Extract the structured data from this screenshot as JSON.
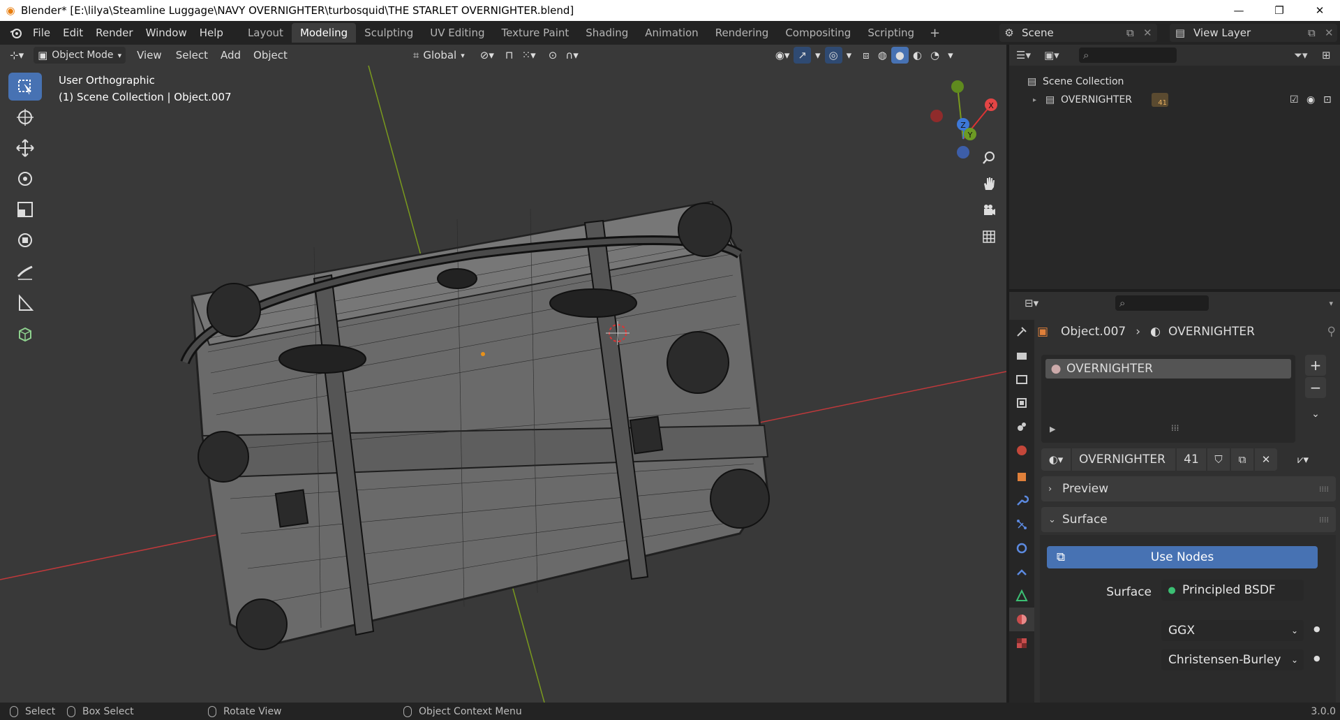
{
  "window": {
    "title": "Blender* [E:\\lilya\\Steamline Luggage\\NAVY OVERNIGHTER\\turbosquid\\THE STARLET OVERNIGHTER.blend]",
    "minimize_glyph": "—",
    "restore_glyph": "❐",
    "close_glyph": "✕"
  },
  "menu": [
    "File",
    "Edit",
    "Render",
    "Window",
    "Help"
  ],
  "workspaces": [
    "Layout",
    "Modeling",
    "Sculpting",
    "UV Editing",
    "Texture Paint",
    "Shading",
    "Animation",
    "Rendering",
    "Compositing",
    "Scripting"
  ],
  "active_workspace": "Modeling",
  "add_workspace": "+",
  "scene": {
    "label": "Scene"
  },
  "view_layer": {
    "label": "View Layer"
  },
  "viewport": {
    "mode": "Object Mode",
    "menus": [
      "View",
      "Select",
      "Add",
      "Object"
    ],
    "transform_orientation": "Global",
    "view_name": "User Orthographic",
    "collection_info": "(1) Scene Collection | Object.007",
    "background": "#393939",
    "grid_x_color": "#c0393b",
    "grid_y_color": "#7a9a1e",
    "gizmo": {
      "z": "Z",
      "y": "Y",
      "x": "X"
    }
  },
  "outliner": {
    "root": "Scene Collection",
    "items": [
      {
        "label": "OVERNIGHTER",
        "badge": "41"
      }
    ]
  },
  "properties": {
    "breadcrumb_object": "Object.007",
    "breadcrumb_material": "OVERNIGHTER",
    "slot_name": "OVERNIGHTER",
    "material_name": "OVERNIGHTER",
    "users": "41",
    "preview_label": "Preview",
    "surface_label": "Surface",
    "use_nodes_label": "Use Nodes",
    "surface_field_label": "Surface",
    "surface_value": "Principled BSDF",
    "distribution": "GGX",
    "subsurface_method": "Christensen-Burley",
    "accent": "#4772b3"
  },
  "statusbar": {
    "select": "Select",
    "box_select": "Box Select",
    "rotate_view": "Rotate View",
    "context_menu": "Object Context Menu",
    "version": "3.0.0"
  }
}
